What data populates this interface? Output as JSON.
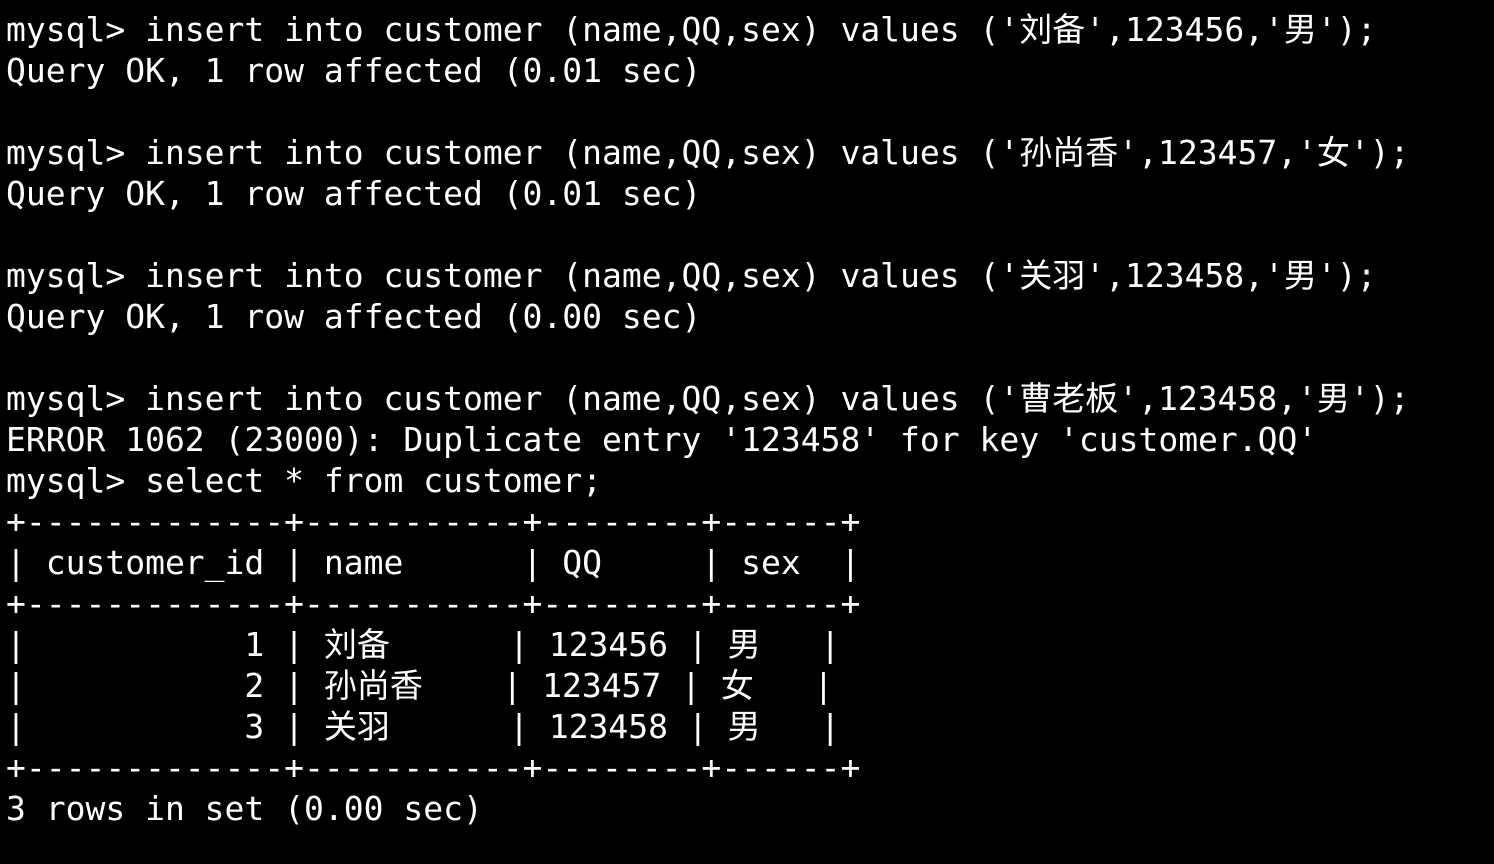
{
  "terminal": {
    "prompt": "mysql> ",
    "colors": {
      "background": "#000000",
      "foreground": "#ffffff"
    },
    "lines": [
      {
        "type": "command",
        "prompt": "mysql> ",
        "text": "insert into customer (name,QQ,sex) values ('刘备',123456,'男');"
      },
      {
        "type": "output",
        "text": "Query OK, 1 row affected (0.01 sec)"
      },
      {
        "type": "blank",
        "text": ""
      },
      {
        "type": "command",
        "prompt": "mysql> ",
        "text": "insert into customer (name,QQ,sex) values ('孙尚香',123457,'女');"
      },
      {
        "type": "output",
        "text": "Query OK, 1 row affected (0.01 sec)"
      },
      {
        "type": "blank",
        "text": ""
      },
      {
        "type": "command",
        "prompt": "mysql> ",
        "text": "insert into customer (name,QQ,sex) values ('关羽',123458,'男');"
      },
      {
        "type": "output",
        "text": "Query OK, 1 row affected (0.00 sec)"
      },
      {
        "type": "blank",
        "text": ""
      },
      {
        "type": "command",
        "prompt": "mysql> ",
        "text": "insert into customer (name,QQ,sex) values ('曹老板',123458,'男');"
      },
      {
        "type": "output",
        "text": "ERROR 1062 (23000): Duplicate entry '123458' for key 'customer.QQ'"
      },
      {
        "type": "command",
        "prompt": "mysql> ",
        "text": "select * from customer;"
      },
      {
        "type": "output",
        "text": "+-------------+-----------+--------+------+"
      },
      {
        "type": "output",
        "text": "| customer_id | name      | QQ     | sex  |"
      },
      {
        "type": "output",
        "text": "+-------------+-----------+--------+------+"
      },
      {
        "type": "output",
        "text": "|           1 | 刘备      | 123456 | 男   |"
      },
      {
        "type": "output",
        "text": "|           2 | 孙尚香    | 123457 | 女   |"
      },
      {
        "type": "output",
        "text": "|           3 | 关羽      | 123458 | 男   |"
      },
      {
        "type": "output",
        "text": "+-------------+-----------+--------+------+"
      },
      {
        "type": "output",
        "text": "3 rows in set (0.00 sec)"
      }
    ]
  }
}
